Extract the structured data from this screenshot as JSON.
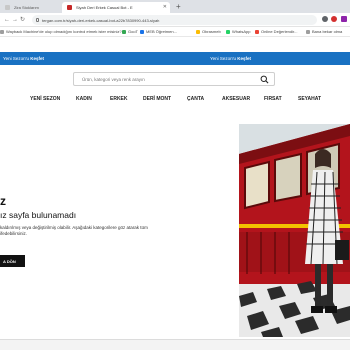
{
  "browser": {
    "tabs": [
      {
        "label": "Zira Stoklarım",
        "active": false
      },
      {
        "label": "Siyah Deri Erkek Casual Bot - E",
        "active": true
      }
    ],
    "new_tab": "+",
    "url": "tergan.com.tr/siyah-deri-erkek-casual-bot-a22b7830990-443-siyah",
    "bookmarks": [
      {
        "label": "Wayback Machine'de olup olmadığını kontrol etmek ister misiniz?",
        "color": "#9e9e9e"
      },
      {
        "label": "GooT",
        "color": "#34a853"
      },
      {
        "label": "MEB Öğretmen...",
        "color": "#1a73e8"
      },
      {
        "label": "Obrasmeb",
        "color": "#fbbc04"
      },
      {
        "label": "WhatsApp",
        "color": "#25d366"
      },
      {
        "label": "Online Değerlendir...",
        "color": "#ea4335"
      },
      {
        "label": "Bana bekar olma",
        "color": "#9e9e9e"
      }
    ]
  },
  "promo": {
    "left_prefix": "Yeni Sezon'u ",
    "left_strong": "Keşfet",
    "right_prefix": "Yeni Sezon'u ",
    "right_strong": "Keşfet"
  },
  "search": {
    "placeholder": "Ürün, kategori veya renk arayın"
  },
  "nav": {
    "items": [
      "YENİ SEZON",
      "KADIN",
      "ERKEK",
      "DERİ MONT",
      "ÇANTA",
      "AKSESUAR",
      "FIRSAT",
      "SEYAHAT"
    ]
  },
  "error": {
    "letter": "z",
    "title": "ız sayfa bulunamadı",
    "description": "kaldırılmış veya değiştirilmiş olabilir. Aşağıdaki kategorilere göz atarak tüm ifedebilirsiniz.",
    "button": "A DÖN"
  },
  "colors": {
    "promo_bg": "#1971c2",
    "button_bg": "#111111"
  }
}
